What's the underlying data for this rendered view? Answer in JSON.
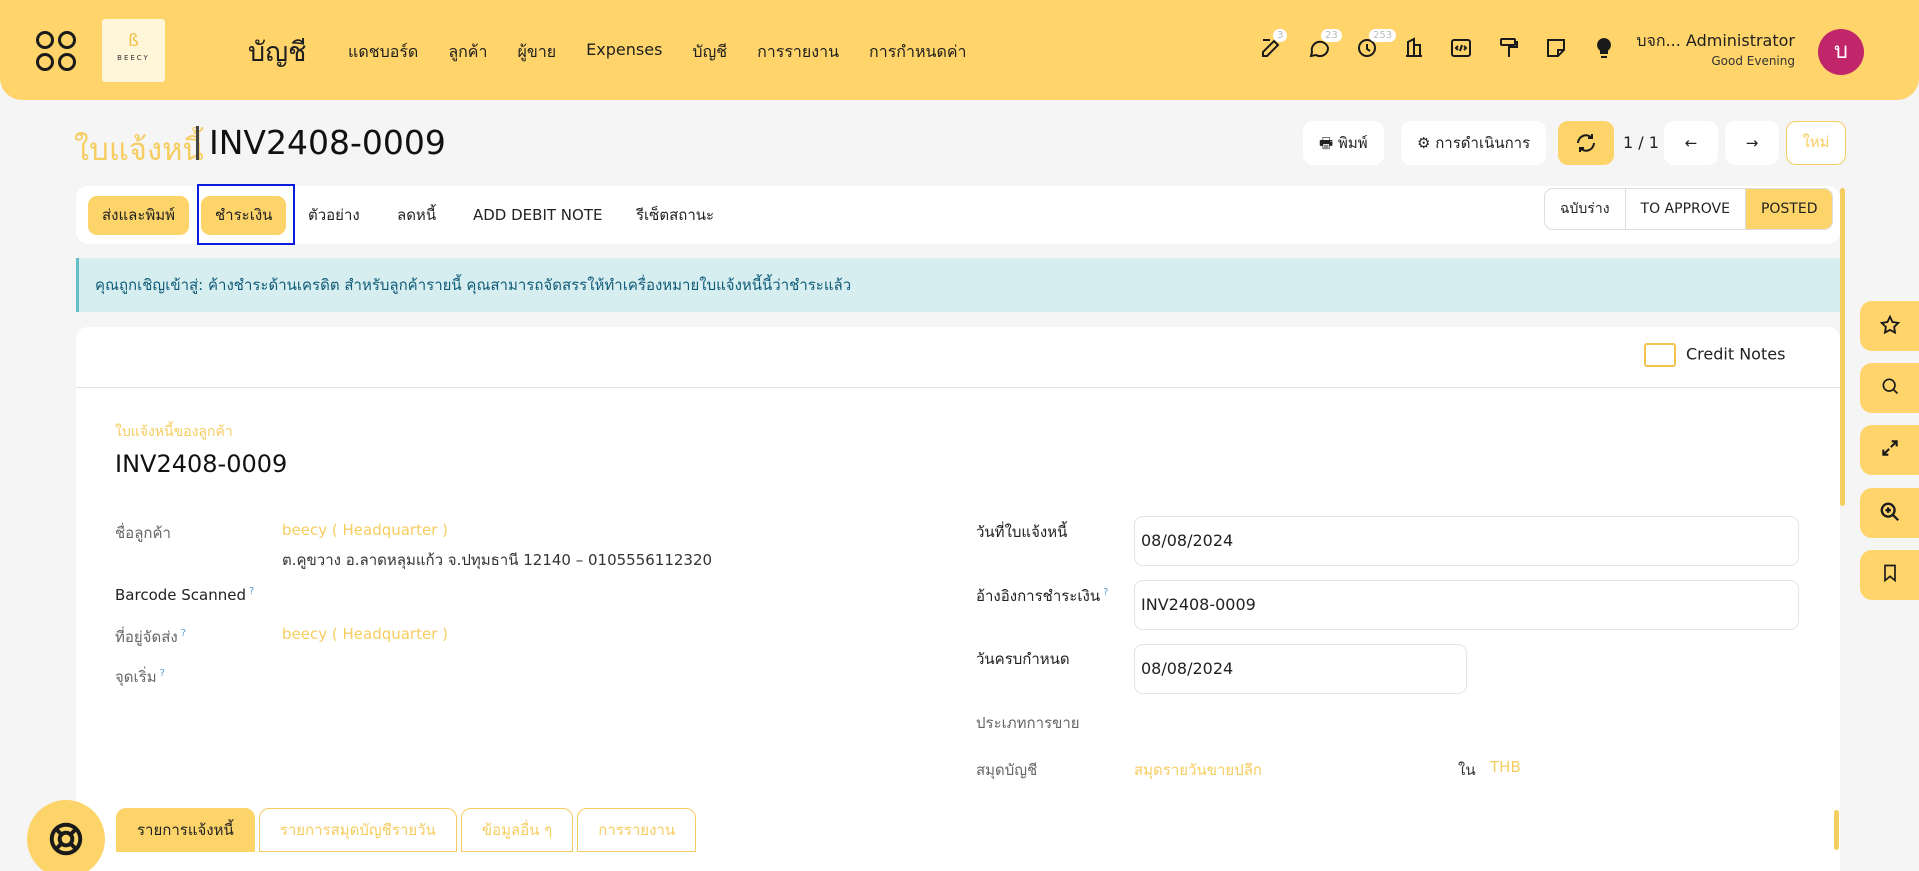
{
  "topbar": {
    "module": "บัญชี",
    "nav": [
      "แดชบอร์ด",
      "ลูกค้า",
      "ผู้ขาย",
      "Expenses",
      "บัญชี",
      "การรายงาน",
      "การกำหนดค่า"
    ],
    "badges": {
      "notes": "3",
      "chat": "23",
      "activity": "253"
    },
    "company": "บจก... Administrator",
    "greeting": "Good Evening",
    "avatar_letter": "บ",
    "logo_text": "BEECY"
  },
  "header": {
    "doc_type": "ใบแจ้งหนี้",
    "doc_name": "INV2408-0009",
    "print": "พิมพ์",
    "actions": "การดำเนินการ",
    "pager": "1 / 1",
    "new": "ใหม่"
  },
  "actionbar": {
    "send_print": "ส่งและพิมพ์",
    "pay": "ชำระเงิน",
    "preview": "ตัวอย่าง",
    "credit": "ลดหนี้",
    "debit": "ADD DEBIT NOTE",
    "reset": "รีเซ็ตสถานะ",
    "statuses": [
      "ฉบับร่าง",
      "TO APPROVE",
      "POSTED"
    ],
    "active_status": "POSTED"
  },
  "alert": "คุณถูกเชิญเข้าสู่: ค้างชำระด้านเครดิต สำหรับลูกค้ารายนี้ คุณสามารถจัดสรรให้ทำเครื่องหมายใบแจ้งหนี้นี้ว่าชำระแล้ว",
  "form": {
    "credit_notes": "Credit Notes",
    "subtitle": "ใบแจ้งหนี้ของลูกค้า",
    "number": "INV2408-0009",
    "customer_label": "ชื่อลูกค้า",
    "customer": "beecy ( Headquarter )",
    "address": "ต.คูขวาง อ.ลาดหลุมแก้ว จ.ปทุมธานี 12140 – 0105556112320",
    "barcode_label": "Barcode Scanned",
    "ship_label": "ที่อยู่จัดส่ง",
    "ship": "beecy ( Headquarter )",
    "origin_label": "จุดเริ่ม",
    "invoice_date_label": "วันที่ใบแจ้งหนี้",
    "invoice_date": "08/08/2024",
    "payment_ref_label": "อ้างอิงการชำระเงิน",
    "payment_ref": "INV2408-0009",
    "due_label": "วันครบกำหนด",
    "due": "08/08/2024",
    "sale_type_label": "ประเภทการขาย",
    "journal_label": "สมุดบัญชี",
    "journal": "สมุดรายวันขายปลีก",
    "in_label": "ใน",
    "currency": "THB",
    "q": "?"
  },
  "tabs": [
    "รายการแจ้งหนี้",
    "รายการสมุดบัญชีรายวัน",
    "ข้อมูลอื่น ๆ",
    "การรายงาน"
  ]
}
